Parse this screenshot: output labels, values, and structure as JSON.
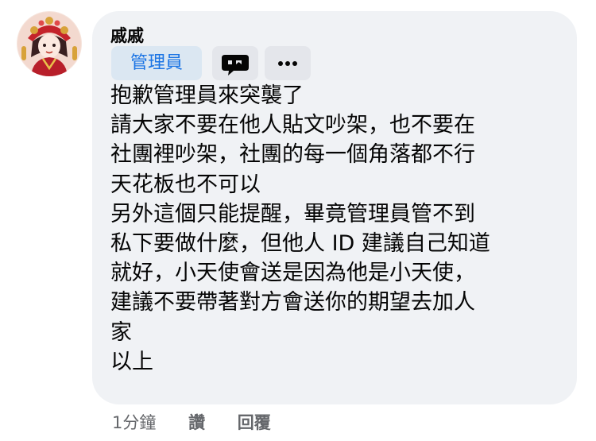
{
  "comment": {
    "author": "戚戚",
    "badge": "管理員",
    "lines": [
      "抱歉管理員來突襲了",
      "請大家不要在他人貼文吵架，也不要在",
      "社團裡吵架，社團的每一個角落都不行",
      "天花板也不可以",
      "另外這個只能提醒，畢竟管理員管不到",
      "私下要做什麼，但他人 ID 建議自己知道",
      "就好，小天使會送是因為他是小天使，",
      "建議不要帶著對方會送你的期望去加人",
      "家",
      "以上"
    ],
    "timestamp": "1分鐘",
    "like_label": "讚",
    "reply_label": "回覆"
  },
  "icons": {
    "message": "message-bubble-icon",
    "more": "more-horizontal-icon"
  },
  "colors": {
    "bubble_bg": "#f0f2f5",
    "badge_bg": "#dbe7f2",
    "badge_text": "#1b74e4",
    "meta_text": "#65676b"
  }
}
